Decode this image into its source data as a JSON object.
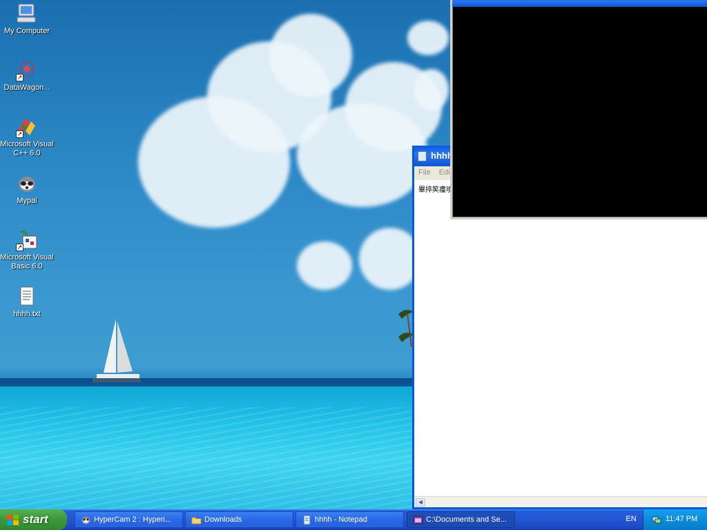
{
  "desktop": {
    "icons": [
      {
        "label": "My Computer",
        "icon": "my-computer-icon"
      },
      {
        "label": "DataWagon...",
        "icon": "datawagon-icon"
      },
      {
        "label": "Microsoft Visual C++ 6.0",
        "icon": "visual-cpp-icon"
      },
      {
        "label": "Mypal",
        "icon": "mypal-icon"
      },
      {
        "label": "Microsoft Visual Basic 6.0",
        "icon": "visual-basic-icon"
      },
      {
        "label": "hhhh.txt",
        "icon": "text-file-icon"
      }
    ]
  },
  "notepad": {
    "title": "hhhh",
    "menu": [
      "File",
      "Edit"
    ],
    "content": "畢捽笶瘽堧"
  },
  "console": {
    "title": "..."
  },
  "taskbar": {
    "start_label": "start",
    "buttons": [
      {
        "label": "HyperCam 2 : Hyperi...",
        "icon": "hypercam-icon",
        "active": false
      },
      {
        "label": "Downloads",
        "icon": "folder-icon",
        "active": false
      },
      {
        "label": "hhhh - Notepad",
        "icon": "notepad-icon",
        "active": false
      },
      {
        "label": "C:\\Documents and Se...",
        "icon": "console-icon",
        "active": true
      }
    ],
    "language": "EN",
    "clock": "11:47 PM"
  },
  "colors": {
    "taskbar_blue": "#245edb",
    "start_green": "#3c9a3a",
    "tray_blue": "#0c8bd8",
    "title_blue": "#0a58e0"
  }
}
